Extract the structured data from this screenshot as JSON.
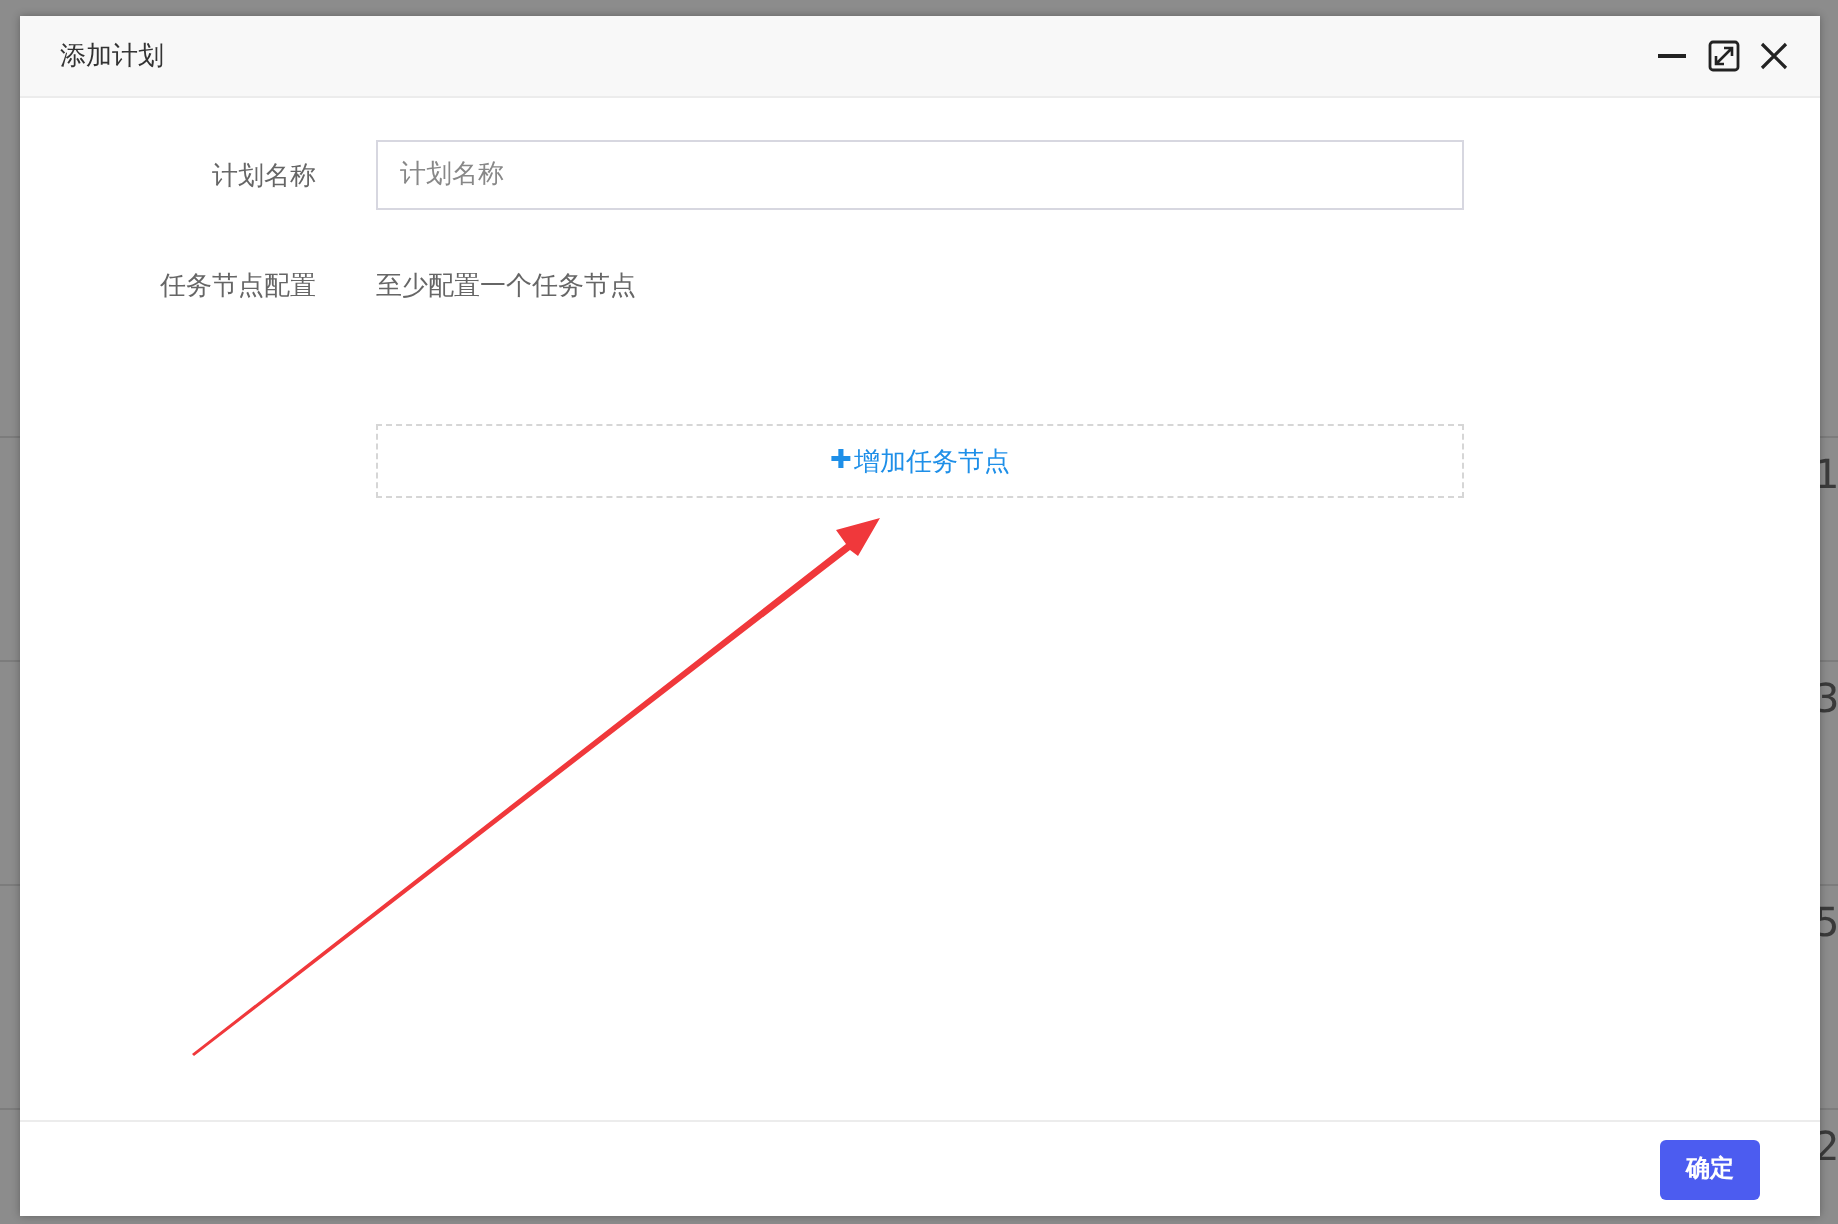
{
  "background_rows": [
    {
      "column_1": "1"
    },
    {
      "column_1": "3"
    },
    {
      "column_1": "5"
    },
    {
      "column_1": "2"
    }
  ],
  "dialog": {
    "title": "添加计划",
    "fields": [
      {
        "kind": "input",
        "label": "计划名称",
        "placeholder": "计划名称"
      },
      {
        "kind": "note",
        "label": "任务节点配置",
        "text": "至少配置一个任务节点"
      }
    ],
    "add_button": {
      "icon": "✚",
      "label": "增加任务节点"
    },
    "confirm_button": "确定"
  }
}
